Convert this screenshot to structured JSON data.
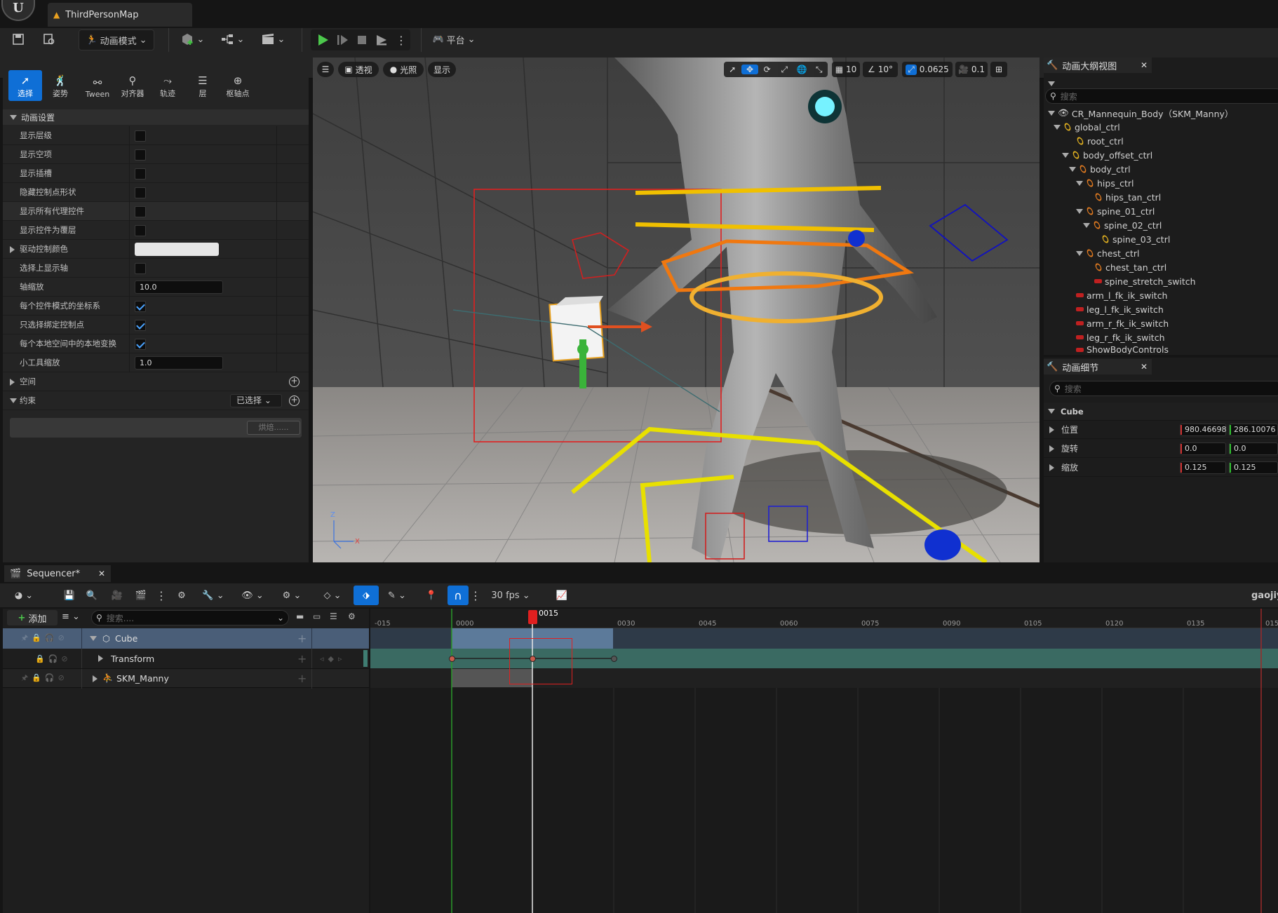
{
  "app": {
    "logo": "U",
    "map_tab": "ThirdPersonMap"
  },
  "toolbar": {
    "mode_label": "动画模式",
    "platform_label": "平台"
  },
  "modes": [
    {
      "label": "选择",
      "icon": "cursor-icon"
    },
    {
      "label": "姿势",
      "icon": "pose-icon"
    },
    {
      "label": "Tween",
      "icon": "tween-icon"
    },
    {
      "label": "对齐器",
      "icon": "snapper-icon"
    },
    {
      "label": "轨迹",
      "icon": "trail-icon"
    },
    {
      "label": "层",
      "icon": "layer-icon"
    },
    {
      "label": "枢轴点",
      "icon": "pivot-icon"
    }
  ],
  "anim_settings": {
    "title": "动画设置",
    "rows": [
      {
        "label": "显示层级",
        "checked": false
      },
      {
        "label": "显示空项",
        "checked": false
      },
      {
        "label": "显示插槽",
        "checked": false
      },
      {
        "label": "隐藏控制点形状",
        "checked": false
      },
      {
        "label": "显示所有代理控件",
        "checked": false
      },
      {
        "label": "显示控件为覆层",
        "checked": false
      },
      {
        "label": "驱动控制颜色",
        "color": "#e6e6e6"
      },
      {
        "label": "选择上显示轴",
        "checked": false
      },
      {
        "label": "轴缩放",
        "value": "10.0"
      },
      {
        "label": "每个控件模式的坐标系",
        "checked": true
      },
      {
        "label": "只选择绑定控制点",
        "checked": true
      },
      {
        "label": "每个本地空间中的本地变换",
        "checked": true
      },
      {
        "label": "小工具缩放",
        "value": "1.0"
      }
    ],
    "space_label": "空间",
    "constraint_label": "约束",
    "constraint_dropdown": "已选择",
    "bake_button": "烘焙......"
  },
  "viewport": {
    "perspective": "透视",
    "lighting": "光照",
    "show": "显示",
    "grid_snap": "10",
    "rot_snap": "10°",
    "scale_snap": "0.0625",
    "camera_speed": "0.1"
  },
  "outliner": {
    "title": "动画大纲视图",
    "search_placeholder": "搜索",
    "items": [
      {
        "label": "CR_Mannequin_Body（SKM_Manny）"
      },
      {
        "label": "global_ctrl"
      },
      {
        "label": "root_ctrl"
      },
      {
        "label": "body_offset_ctrl"
      },
      {
        "label": "body_ctrl"
      },
      {
        "label": "hips_ctrl"
      },
      {
        "label": "hips_tan_ctrl"
      },
      {
        "label": "spine_01_ctrl"
      },
      {
        "label": "spine_02_ctrl"
      },
      {
        "label": "spine_03_ctrl"
      },
      {
        "label": "chest_ctrl"
      },
      {
        "label": "chest_tan_ctrl"
      },
      {
        "label": "spine_stretch_switch"
      },
      {
        "label": "arm_l_fk_ik_switch"
      },
      {
        "label": "leg_l_fk_ik_switch"
      },
      {
        "label": "arm_r_fk_ik_switch"
      },
      {
        "label": "leg_r_fk_ik_switch"
      },
      {
        "label": "ShowBodyControls"
      }
    ]
  },
  "details": {
    "title": "动画细节",
    "search_placeholder": "搜索",
    "section": "Cube",
    "rows": [
      {
        "label": "位置",
        "x": "980.46698",
        "y": "286.10076"
      },
      {
        "label": "旋转",
        "x": "0.0",
        "y": "0.0"
      },
      {
        "label": "缩放",
        "x": "0.125",
        "y": "0.125"
      }
    ]
  },
  "sequencer": {
    "tab_title": "Sequencer*",
    "fps": "30 fps",
    "user": "gaojiy",
    "add_label": "添加",
    "search_placeholder": "搜索....",
    "tracks": [
      {
        "label": "Cube"
      },
      {
        "label": "Transform"
      },
      {
        "label": "SKM_Manny"
      }
    ],
    "current_frame": "0015",
    "ticks": [
      "-015",
      "0000",
      "0030",
      "0045",
      "0060",
      "0075",
      "0090",
      "0105",
      "0120",
      "0135",
      "015"
    ]
  }
}
